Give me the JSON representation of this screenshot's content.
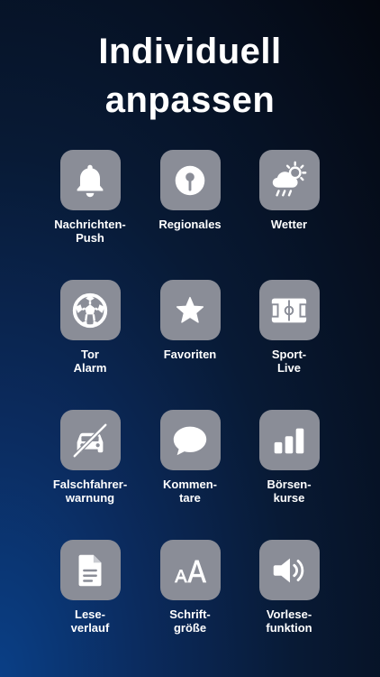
{
  "header": {
    "line1": "Individuell",
    "line2": "anpassen"
  },
  "tiles": [
    {
      "icon": "bell-icon",
      "line1": "Nachrichten-",
      "line2": "Push"
    },
    {
      "icon": "map-pin-icon",
      "line1": "Regionales",
      "line2": ""
    },
    {
      "icon": "weather-icon",
      "line1": "Wetter",
      "line2": ""
    },
    {
      "icon": "soccer-ball-icon",
      "line1": "Tor",
      "line2": "Alarm"
    },
    {
      "icon": "star-icon",
      "line1": "Favoriten",
      "line2": ""
    },
    {
      "icon": "soccer-field-icon",
      "line1": "Sport-",
      "line2": "Live"
    },
    {
      "icon": "wrong-way-car-icon",
      "line1": "Falschfahrer-",
      "line2": "warnung"
    },
    {
      "icon": "speech-bubble-icon",
      "line1": "Kommen-",
      "line2": "tare"
    },
    {
      "icon": "bar-chart-icon",
      "line1": "Börsen-",
      "line2": "kurse"
    },
    {
      "icon": "document-icon",
      "line1": "Lese-",
      "line2": "verlauf"
    },
    {
      "icon": "font-size-icon",
      "line1": "Schrift-",
      "line2": "größe"
    },
    {
      "icon": "speaker-icon",
      "line1": "Vorlese-",
      "line2": "funktion"
    }
  ],
  "colors": {
    "tile_bg": "#8a8d97",
    "icon_fg": "#ffffff"
  }
}
